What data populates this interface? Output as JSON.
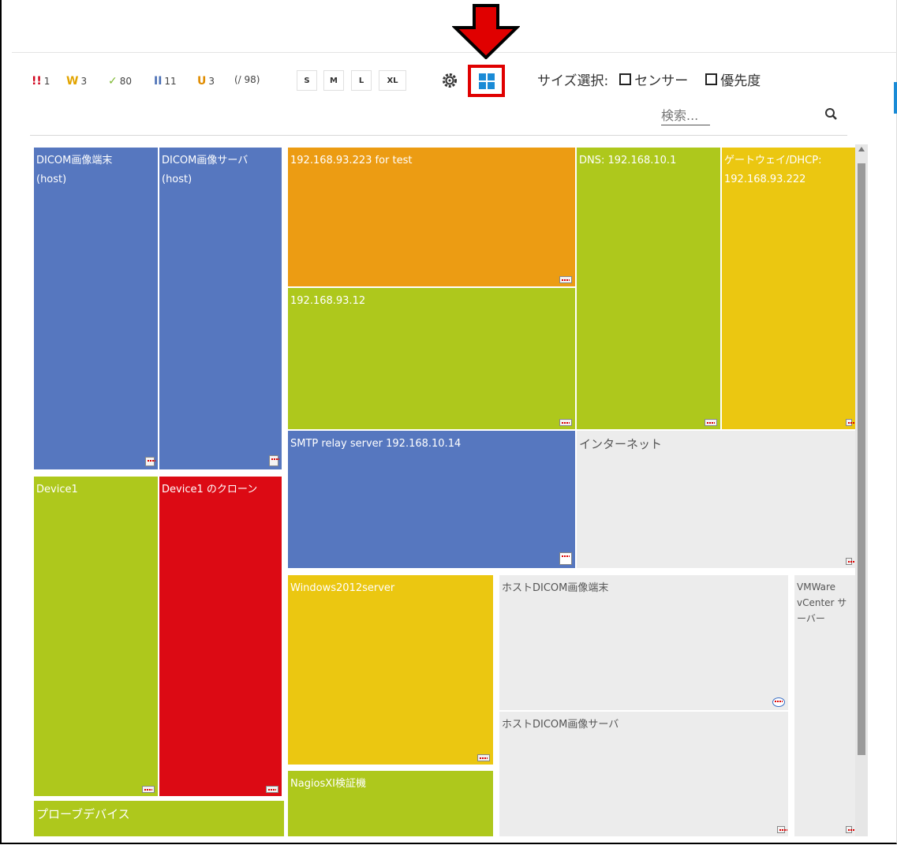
{
  "status_counts": [
    {
      "glyph": "!!",
      "count": "1",
      "color": "#d0021b",
      "name": "error"
    },
    {
      "glyph": "W",
      "count": "3",
      "color": "#e2a400",
      "name": "warning"
    },
    {
      "glyph": "✓",
      "count": "80",
      "color": "#7cb82f",
      "name": "ok"
    },
    {
      "glyph": "II",
      "count": "11",
      "color": "#4a6fb5",
      "name": "paused"
    },
    {
      "glyph": "U",
      "count": "3",
      "color": "#e08c00",
      "name": "unusual"
    }
  ],
  "total": "(/ 98)",
  "size_buttons": [
    "S",
    "M",
    "L",
    "XL"
  ],
  "size_select": {
    "label": "サイズ選択:",
    "options": [
      "センサー",
      "優先度"
    ]
  },
  "search": {
    "placeholder": "検索..."
  },
  "tiles": {
    "dicom_terminal": {
      "line1": "DICOM画像端末",
      "line2": "(host)"
    },
    "dicom_server": {
      "line1": "DICOM画像サーバ",
      "line2": "(host)"
    },
    "ip223": {
      "line1": "192.168.93.223 for test"
    },
    "dns": {
      "line1": "DNS: 192.168.10.1"
    },
    "gateway": {
      "line1": "ゲートウェイ/DHCP:",
      "line2": "192.168.93.222"
    },
    "ip12": {
      "line1": "192.168.93.12"
    },
    "smtp": {
      "line1": "SMTP relay server 192.168.10.14"
    },
    "internet": {
      "line1": "インターネット"
    },
    "device1": {
      "line1": "Device1"
    },
    "device1_clone": {
      "line1": "Device1 のクローン"
    },
    "win2012": {
      "line1": "Windows2012server"
    },
    "host_dicom_terminal": {
      "line1": "ホストDICOM画像端末"
    },
    "vmware": {
      "line1": "VMWare",
      "line2": "vCenter サ",
      "line3": "ーバー"
    },
    "host_dicom_server": {
      "line1": "ホストDICOM画像サーバ"
    },
    "nagios": {
      "line1": "NagiosXI検証機"
    },
    "probe": {
      "line1": "プローブデバイス"
    }
  },
  "colors": {
    "blue": "#5677bf",
    "orange": "#ec9c13",
    "green": "#aec81c",
    "yellow": "#ebc711",
    "red": "#dc0a14",
    "gray": "#ececec",
    "highlight": "#e00000"
  }
}
